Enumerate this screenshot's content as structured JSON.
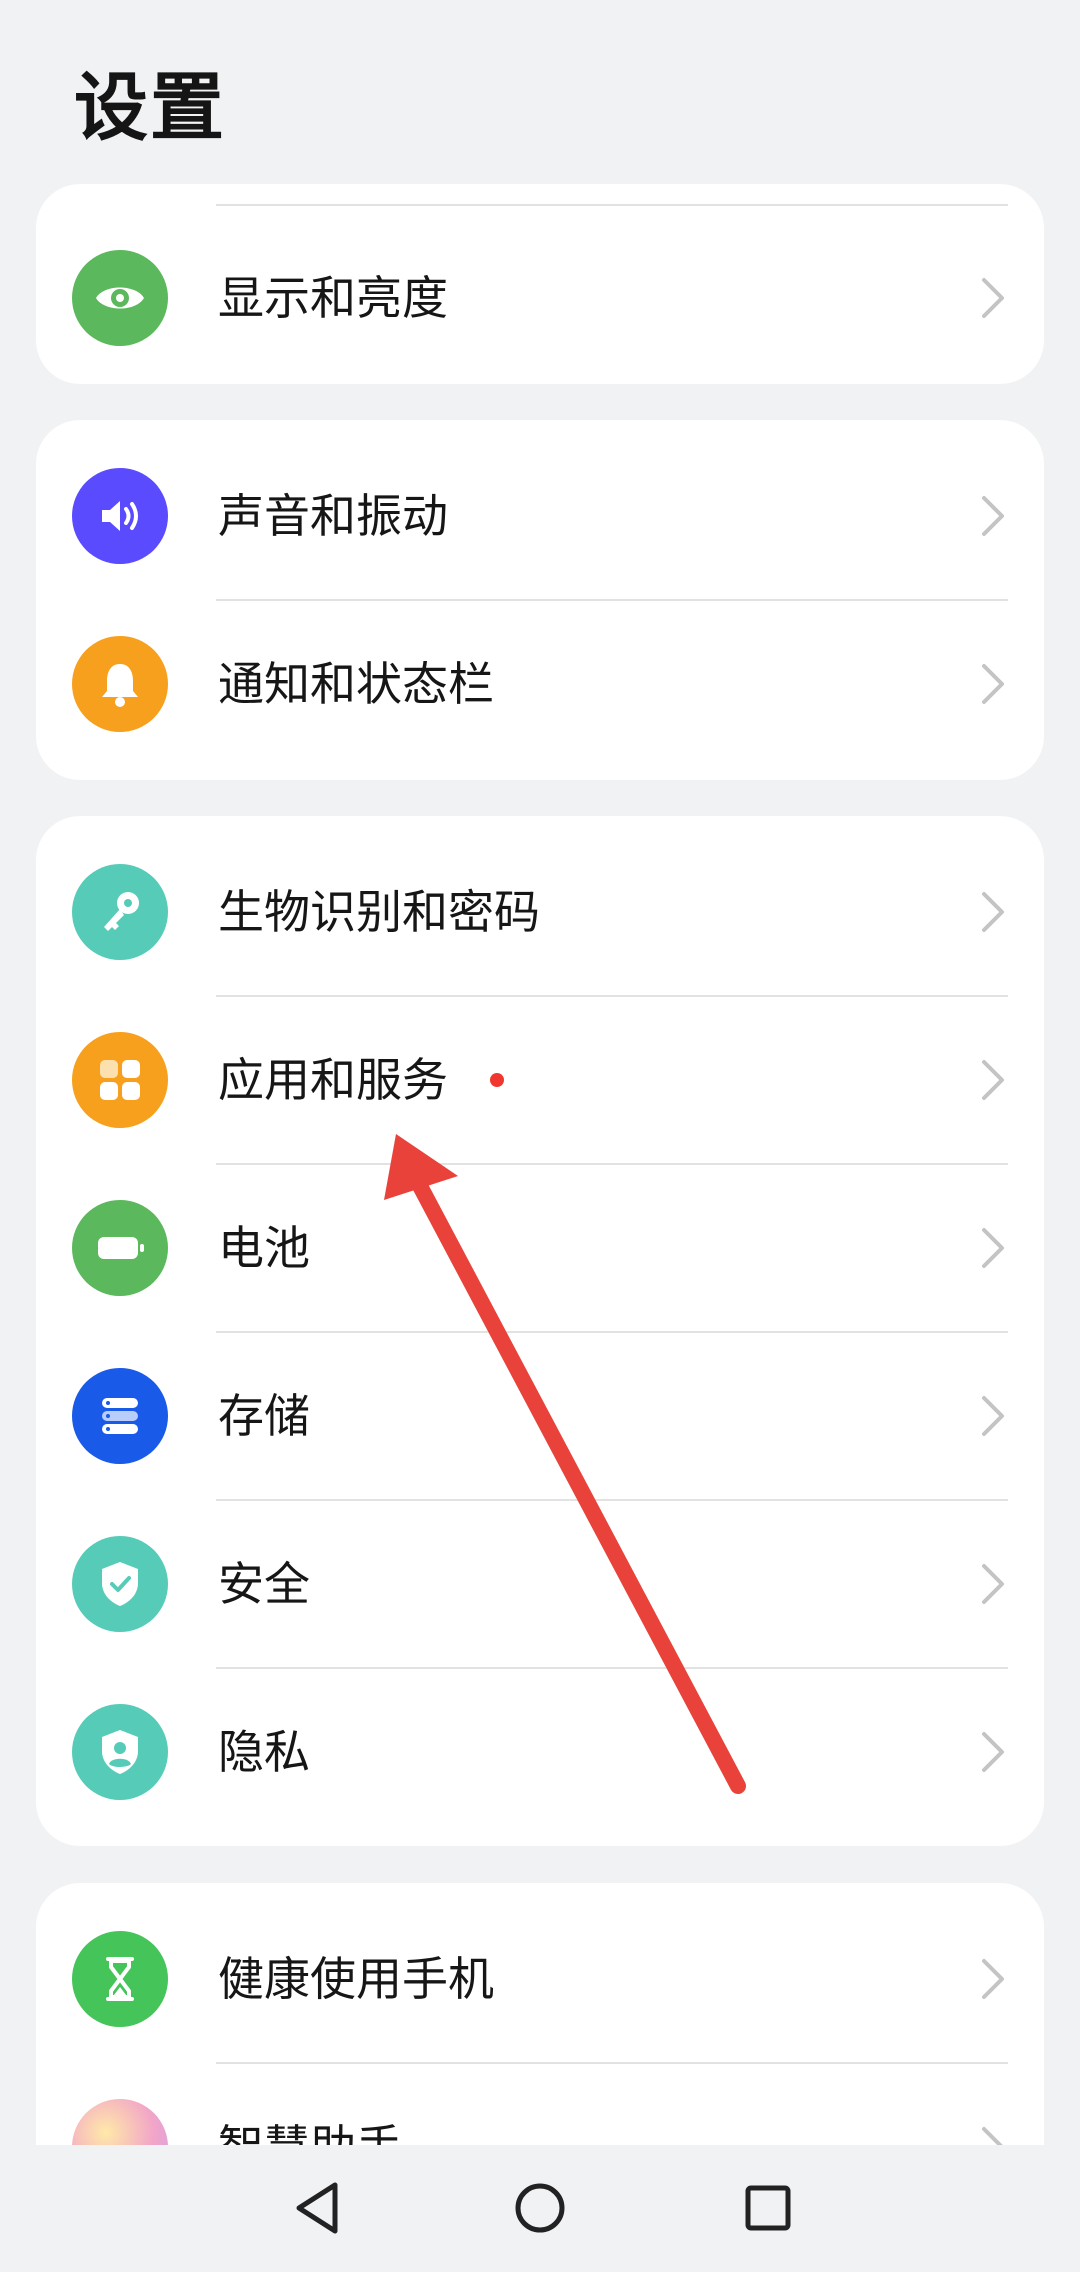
{
  "header": {
    "title": "设置"
  },
  "groups": [
    {
      "items": [
        {
          "label": "显示和亮度",
          "icon": "eye-icon",
          "color": "#5cb85c"
        }
      ]
    },
    {
      "items": [
        {
          "label": "声音和振动",
          "icon": "speaker-icon",
          "color": "#5a4bff"
        },
        {
          "label": "通知和状态栏",
          "icon": "bell-icon",
          "color": "#f7a01d"
        }
      ]
    },
    {
      "items": [
        {
          "label": "生物识别和密码",
          "icon": "key-icon",
          "color": "#56ccb8"
        },
        {
          "label": "应用和服务",
          "icon": "apps-grid-icon",
          "color": "#f7a01d",
          "badge": "red-dot"
        },
        {
          "label": "电池",
          "icon": "battery-icon",
          "color": "#5cb85c"
        },
        {
          "label": "存储",
          "icon": "storage-icon",
          "color": "#1a5ae8"
        },
        {
          "label": "安全",
          "icon": "shield-check-icon",
          "color": "#56ccb8"
        },
        {
          "label": "隐私",
          "icon": "privacy-shield-icon",
          "color": "#56ccb8"
        }
      ]
    },
    {
      "items": [
        {
          "label": "健康使用手机",
          "icon": "hourglass-icon",
          "color": "#45c45a"
        },
        {
          "label": "智慧助手",
          "icon": "assistant-orb-icon",
          "color": "#f2a5c8"
        }
      ]
    }
  ],
  "navbar": {
    "back": "back-icon",
    "home": "home-icon",
    "recents": "recents-icon"
  },
  "colors": {
    "background": "#f1f2f4",
    "card": "#ffffff",
    "annotation_arrow": "#e8423a",
    "badge": "#f0372f"
  }
}
